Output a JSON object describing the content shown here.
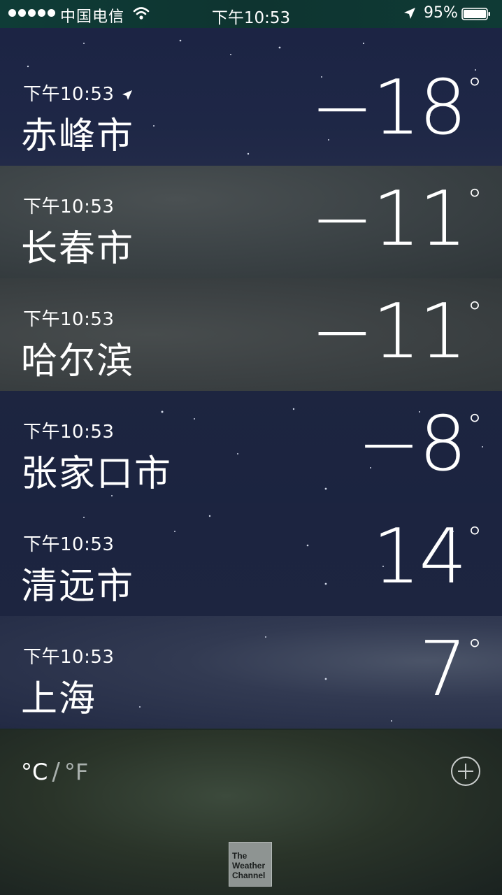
{
  "status_bar": {
    "carrier": "中国电信",
    "time": "下午10:53",
    "battery": "95%"
  },
  "cities": [
    {
      "time": "下午10:53",
      "name": "赤峰市",
      "temp": "−18",
      "deg": "°",
      "current_location": true
    },
    {
      "time": "下午10:53",
      "name": "长春市",
      "temp": "−11",
      "deg": "°"
    },
    {
      "time": "下午10:53",
      "name": "哈尔滨",
      "temp": "−11",
      "deg": "°"
    },
    {
      "time": "下午10:53",
      "name": "张家口市",
      "temp": "−8",
      "deg": "°"
    },
    {
      "time": "下午10:53",
      "name": "清远市",
      "temp": "14",
      "deg": "°"
    },
    {
      "time": "下午10:53",
      "name": "上海",
      "temp": "7",
      "deg": "°"
    }
  ],
  "footer": {
    "unit_c": "°C",
    "unit_sep": "/",
    "unit_f": "°F",
    "logo_line1": "The",
    "logo_line2": "Weather",
    "logo_line3": "Channel"
  },
  "colors": {
    "status_bar": "#0f3c37",
    "night_row": "#1c2540",
    "cloud_row": "#3b4245",
    "footer": "#2a3429"
  },
  "icons": {
    "signal": "signal-dots-icon",
    "wifi": "wifi-icon",
    "location": "location-arrow-icon",
    "battery": "battery-icon",
    "add": "plus-circle-icon"
  }
}
